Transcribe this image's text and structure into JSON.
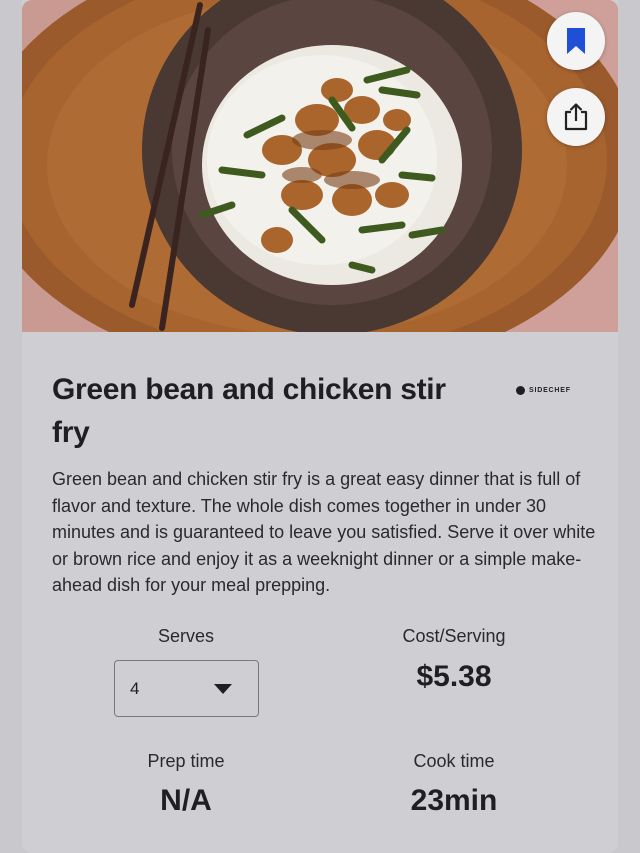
{
  "recipe": {
    "title": "Green bean and chicken stir fry",
    "brand": "SIDECHEF",
    "description": "Green bean and chicken stir fry is a great easy dinner that is full of flavor and texture. The whole dish comes together in under 30 minutes and is guaranteed to leave you satisfied. Serve it over white or brown rice and enjoy it as a weeknight dinner or a simple make-ahead dish for your meal prepping."
  },
  "stats": {
    "serves_label": "Serves",
    "serves_value": "4",
    "cost_label": "Cost/Serving",
    "cost_value": "$5.38",
    "prep_label": "Prep time",
    "prep_value": "N/A",
    "cook_label": "Cook time",
    "cook_value": "23min"
  },
  "icons": {
    "bookmark": "bookmark-icon",
    "share": "share-icon",
    "dropdown": "caret-down-icon"
  },
  "colors": {
    "bookmark": "#1f4fd6",
    "background": "#c9c9cd"
  }
}
